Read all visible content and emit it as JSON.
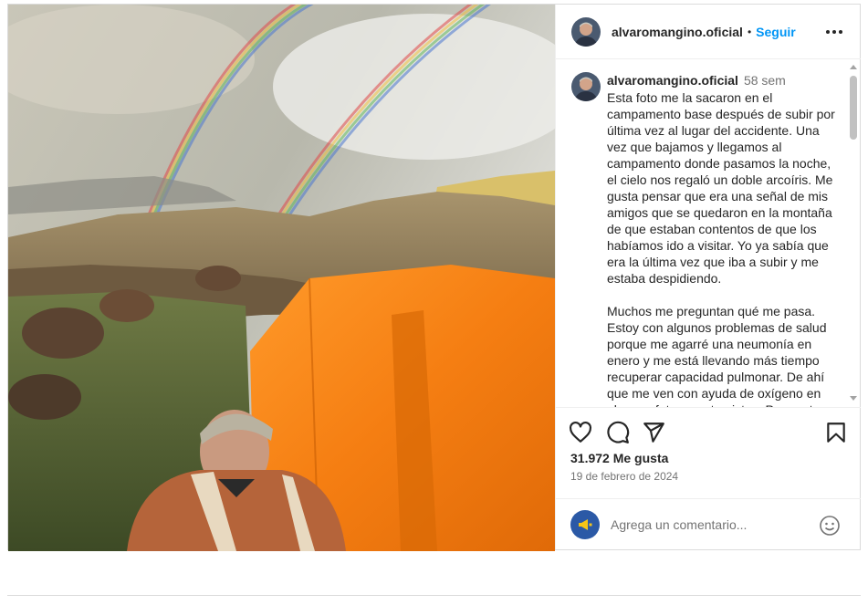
{
  "post": {
    "username": "alvaromangino.oficial",
    "separator": "•",
    "follow_label": "Seguir",
    "more_icon": "more-horizontal-icon",
    "caption": {
      "username": "alvaromangino.oficial",
      "time": "58 sem",
      "text": "Esta foto me la sacaron en el campamento base después de subir por última vez al lugar del accidente. Una vez que bajamos y llegamos al campamento donde pasamos la noche, el cielo nos regaló un doble arcoíris. Me gusta pensar que era una señal de mis amigos que se quedaron en la montaña de que estaban contentos de que los habíamos ido a visitar. Yo ya sabía que era la última vez que iba a subir y me estaba despidiendo.\n\nMuchos me preguntan qué me pasa. Estoy con algunos problemas de salud porque me agarré una neumonía en enero y me está llevando más tiempo recuperar capacidad pulmonar. De ahí que me ven con ayuda de oxígeno en algunas fotos y entrevistas. Pero estoy"
    },
    "actions": {
      "like_icon": "heart-icon",
      "comment_icon": "comment-icon",
      "share_icon": "send-icon",
      "save_icon": "bookmark-icon"
    },
    "likes": "31.972 Me gusta",
    "date": "19 de febrero de 2024",
    "comment_placeholder": "Agrega un comentario...",
    "emoji_icon": "emoji-smile-icon"
  },
  "colors": {
    "link_blue": "#0095f6",
    "text": "#262626",
    "secondary_text": "#737373",
    "border": "#dbdbdb",
    "tent_orange": "#f57e12"
  }
}
